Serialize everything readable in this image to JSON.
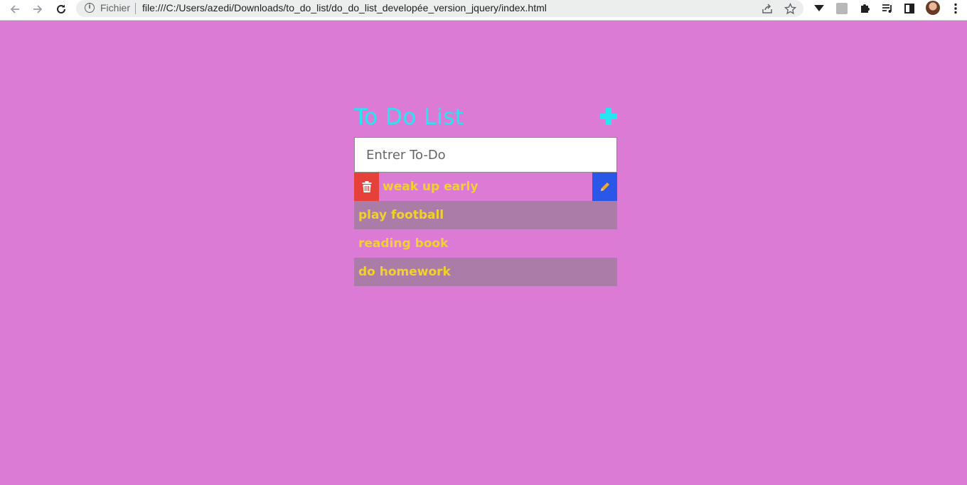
{
  "browser": {
    "site_label": "Fichier",
    "url": "file:///C:/Users/azedi/Downloads/to_do_list/do_do_list_developée_version_jquery/index.html",
    "nav_icons": [
      "back-arrow-icon",
      "forward-arrow-icon",
      "reload-icon"
    ],
    "toolbar_icons": [
      "share-icon",
      "star-icon",
      "download-arrow-icon",
      "pdf-extension-icon",
      "puzzle-extensions-icon",
      "media-queue-icon",
      "side-panel-icon",
      "profile-avatar",
      "kebab-menu-icon"
    ]
  },
  "app": {
    "title": "To Do List",
    "input_placeholder": "Entrer To-Do",
    "add_icon": "plus-icon",
    "todos": [
      {
        "text": "weak up early",
        "hovered": true
      },
      {
        "text": "play football",
        "hovered": false
      },
      {
        "text": "reading book",
        "hovered": false
      },
      {
        "text": "do homework",
        "hovered": false
      }
    ]
  },
  "colors": {
    "page_background": "#dc7bd5",
    "title_color": "#27e6f2",
    "todo_text": "#f0d32a",
    "alt_row": "#ac7ca8",
    "delete_button": "#e5403a",
    "edit_button": "#2b57e8",
    "pencil_icon": "#f5a623"
  }
}
